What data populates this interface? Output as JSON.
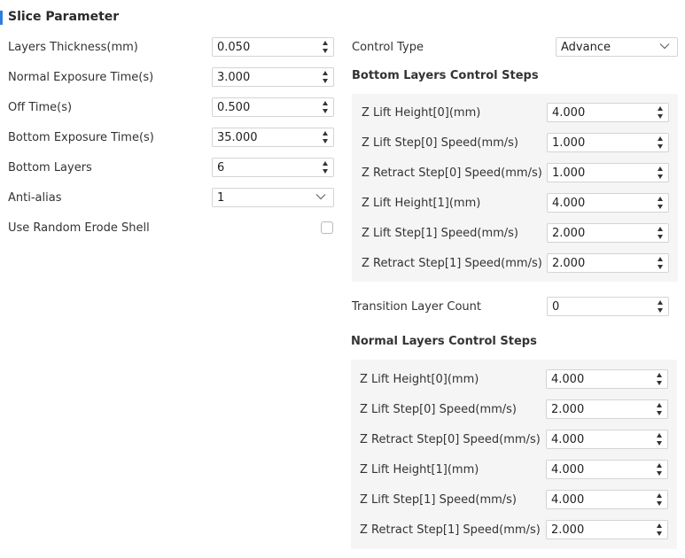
{
  "section_title": "Slice Parameter",
  "left_params": [
    {
      "label": "Layers Thickness(mm)",
      "value": "0.050",
      "control": "spin"
    },
    {
      "label": "Normal Exposure Time(s)",
      "value": "3.000",
      "control": "spin"
    },
    {
      "label": "Off Time(s)",
      "value": "0.500",
      "control": "spin"
    },
    {
      "label": "Bottom Exposure Time(s)",
      "value": "35.000",
      "control": "spin"
    },
    {
      "label": "Bottom Layers",
      "value": "6",
      "control": "spin"
    },
    {
      "label": "Anti-alias",
      "value": "1",
      "control": "select"
    },
    {
      "label": "Use Random Erode Shell",
      "checked": false,
      "control": "checkbox"
    }
  ],
  "control_type": {
    "label": "Control Type",
    "value": "Advance"
  },
  "bottom_steps": {
    "title": "Bottom Layers Control Steps",
    "rows": [
      {
        "label": "Z Lift Height[0](mm)",
        "value": "4.000"
      },
      {
        "label": "Z Lift Step[0] Speed(mm/s)",
        "value": "1.000"
      },
      {
        "label": "Z Retract Step[0] Speed(mm/s)",
        "value": "1.000"
      },
      {
        "label": "Z Lift Height[1](mm)",
        "value": "4.000"
      },
      {
        "label": "Z Lift Step[1] Speed(mm/s)",
        "value": "2.000"
      },
      {
        "label": "Z Retract Step[1] Speed(mm/s)",
        "value": "2.000"
      }
    ]
  },
  "transition": {
    "label": "Transition Layer Count",
    "value": "0"
  },
  "normal_steps": {
    "title": "Normal Layers Control Steps",
    "rows": [
      {
        "label": "Z Lift Height[0](mm)",
        "value": "4.000"
      },
      {
        "label": "Z Lift Step[0] Speed(mm/s)",
        "value": "2.000"
      },
      {
        "label": "Z Retract Step[0] Speed(mm/s)",
        "value": "4.000"
      },
      {
        "label": "Z Lift Height[1](mm)",
        "value": "4.000"
      },
      {
        "label": "Z Lift Step[1] Speed(mm/s)",
        "value": "4.000"
      },
      {
        "label": "Z Retract Step[1] Speed(mm/s)",
        "value": "2.000"
      }
    ]
  },
  "colors": {
    "accent": "#2f7de1",
    "panel": "#f5f5f5",
    "border": "#d4d4d4"
  }
}
